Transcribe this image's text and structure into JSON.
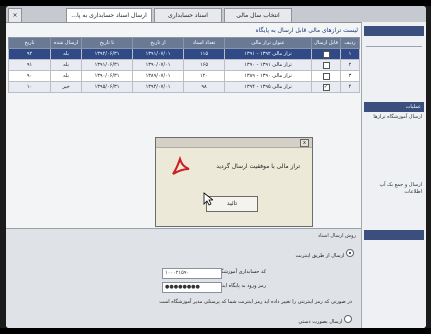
{
  "tabs": [
    {
      "label": "انتخاب سال مالی"
    },
    {
      "label": "اسناد حسابداری"
    },
    {
      "label": "ارسال اسناد حسابداری به پا..."
    }
  ],
  "page": {
    "section_title": "لیست ترازهای مالی قابل ارسال به پایگاه"
  },
  "grid": {
    "columns": [
      "ردیف",
      "قابل ارسال",
      "عنوان تراز مالی",
      "تعداد اسناد",
      "از تاریخ",
      "تا تاریخ",
      "ارسال شده",
      "تاریخ"
    ],
    "rows": [
      {
        "n": "۱",
        "title": "تراز مالی ۱۳۹۲ - ۱۳۹۱",
        "count": "۱۱۵",
        "from": "۱۳۹۱/۰۷/۰۱",
        "to": "۱۳۹۲/۰۶/۳۱",
        "sent": "بله",
        "date": "۹۲",
        "checked": false,
        "selected": true
      },
      {
        "n": "۲",
        "title": "تراز مالی ۱۳۹۱ - ۱۳۹۰",
        "count": "۱۶۵",
        "from": "۱۳۹۰/۰۷/۰۱",
        "to": "۱۳۹۱/۰۶/۳۱",
        "sent": "بله",
        "date": "۹۱",
        "checked": false,
        "selected": false
      },
      {
        "n": "۳",
        "title": "تراز مالی ۱۳۹۰ - ۱۳۸۹",
        "count": "۱۲۰",
        "from": "۱۳۸۹/۰۷/۰۱",
        "to": "۱۳۹۰/۰۶/۳۱",
        "sent": "بله",
        "date": "۹۰",
        "checked": false,
        "selected": false
      },
      {
        "n": "۴",
        "title": "تراز مالی ۱۳۹۵ - ۱۳۹۴",
        "count": "۹۸",
        "from": "۱۳۹۴/۰۷/۰۱",
        "to": "۱۳۹۵/۰۶/۳۱",
        "sent": "خیر",
        "date": "۱۰",
        "checked": true,
        "selected": false
      }
    ]
  },
  "send_options": {
    "legend": "روش ارسال اسناد",
    "internet_option": "ارسال از طریق اینترنت",
    "school_code_label": "کد حسابداری آموزشگاه :",
    "school_code_value": "۱۰۰۰۲۱۵۹۰",
    "password_label": "رمز ورود به پایگاه اینترنتی :",
    "password_value": "●●●●●●●●",
    "note": "در صورتی که رمز اینترنتی را تغییر داده اید رمز اینترنت شما که پرسنلی مدیر آموزشگاه است",
    "other_option": "ارسال بصورت دستی"
  },
  "right_panel": {
    "items": [
      "",
      "عملیات",
      "ارسال آموزشگاه ترازها",
      "ارسال و جمع بک آپ اطلاعات"
    ]
  },
  "dialog": {
    "close": "x",
    "message": "تراز مالی با موفقیت ارسال گردید",
    "ok": "تائید"
  },
  "colors": {
    "accent": "#2f4a86",
    "pdf_red": "#cc1f1f"
  }
}
